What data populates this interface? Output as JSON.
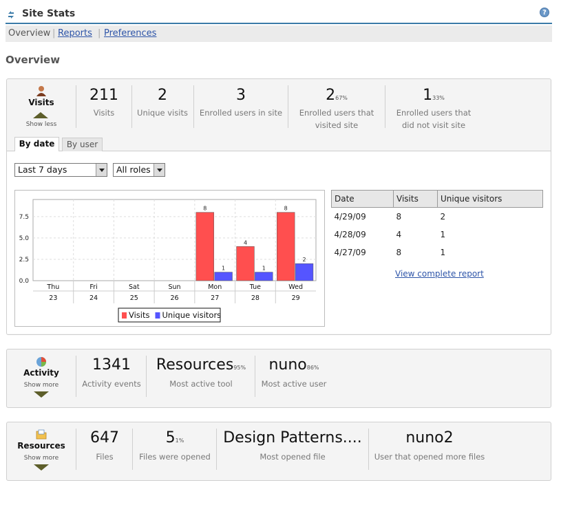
{
  "header": {
    "title": "Site Stats",
    "help_icon": "?"
  },
  "nav": {
    "items": [
      {
        "label": "Overview"
      },
      {
        "label": "Reports"
      },
      {
        "label": "Preferences"
      }
    ]
  },
  "page_title": "Overview",
  "visits": {
    "title": "Visits",
    "toggle": "Show less",
    "stats": [
      {
        "value": "211",
        "pct": "",
        "label": "Visits"
      },
      {
        "value": "2",
        "pct": "",
        "label": "Unique visits"
      },
      {
        "value": "3",
        "pct": "",
        "label": "Enrolled users in site"
      },
      {
        "value": "2",
        "pct": "67%",
        "label_lines": [
          "Enrolled users that",
          "visited site"
        ]
      },
      {
        "value": "1",
        "pct": "33%",
        "label_lines": [
          "Enrolled users that",
          "did not visit site"
        ]
      }
    ],
    "tabs": [
      "By date",
      "By user"
    ],
    "period_select": "Last 7 days",
    "roles_select": "All roles",
    "table": {
      "headers": [
        "Date",
        "Visits",
        "Unique visitors"
      ],
      "rows": [
        [
          "4/29/09",
          "8",
          "2"
        ],
        [
          "4/28/09",
          "4",
          "1"
        ],
        [
          "4/27/09",
          "8",
          "1"
        ]
      ]
    },
    "report_link": "View complete report"
  },
  "chart_data": {
    "type": "bar",
    "categories": [
      "Thu",
      "Fri",
      "Sat",
      "Sun",
      "Mon",
      "Tue",
      "Wed"
    ],
    "category_dates": [
      "23",
      "24",
      "25",
      "26",
      "27",
      "28",
      "29"
    ],
    "series": [
      {
        "name": "Visits",
        "values": [
          0,
          0,
          0,
          0,
          8,
          4,
          8
        ],
        "color": "#ff4f4f"
      },
      {
        "name": "Unique visitors",
        "values": [
          0,
          0,
          0,
          0,
          1,
          1,
          2
        ],
        "color": "#5555ff"
      }
    ],
    "yticks": [
      "0.0",
      "2.5",
      "5.0",
      "7.5"
    ],
    "ylim": [
      0,
      9.5
    ],
    "grid": true,
    "legend": "bottom"
  },
  "activity": {
    "title": "Activity",
    "toggle": "Show more",
    "stats": [
      {
        "value": "1341",
        "pct": "",
        "label": "Activity events"
      },
      {
        "value": "Resources",
        "pct": "95%",
        "label": "Most active tool"
      },
      {
        "value": "nuno",
        "pct": "86%",
        "label": "Most active user"
      }
    ]
  },
  "resources": {
    "title": "Resources",
    "toggle": "Show more",
    "stats": [
      {
        "value": "647",
        "pct": "",
        "label": "Files"
      },
      {
        "value": "5",
        "pct": "1%",
        "label": "Files were opened"
      },
      {
        "value": "Design Patterns....",
        "pct": "",
        "label": "Most opened file"
      },
      {
        "value": "nuno2",
        "pct": "",
        "label": "User that opened more files"
      }
    ]
  },
  "colors": {
    "accent": "#3a7aa8",
    "link": "#2d54a8",
    "arrow": "#5d5e2a"
  }
}
